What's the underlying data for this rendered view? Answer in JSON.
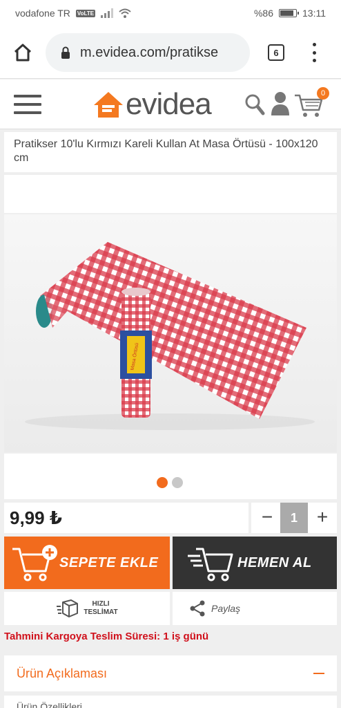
{
  "status_bar": {
    "carrier": "vodafone TR",
    "volte": "VoLTE",
    "battery": "%86",
    "time": "13:11"
  },
  "browser": {
    "url": "m.evidea.com/pratikse",
    "tab_count": "6"
  },
  "header": {
    "logo_text": "evidea",
    "cart_count": "0"
  },
  "product": {
    "title": "Pratikser 10'lu Kırmızı Kareli Kullan At Masa Örtüsü - 100x120 cm",
    "price": "9,99 ₺",
    "quantity": "1",
    "qty_minus": "−",
    "qty_plus": "+",
    "roll_label": "Masa Örtüsü"
  },
  "actions": {
    "add_to_cart": "SEPETE EKLE",
    "buy_now": "HEMEN AL",
    "fast_delivery_line1": "HIZLI",
    "fast_delivery_line2": "TESLİMAT",
    "share": "Paylaş"
  },
  "delivery_text": "Tahmini Kargoya Teslim Süresi: 1 iş günü",
  "sections": {
    "description": "Ürün Açıklaması",
    "next": "Ürün Özellikleri"
  },
  "colors": {
    "brand_orange": "#f26b1d",
    "dark_button": "#333333",
    "alert_red": "#d0101b"
  }
}
